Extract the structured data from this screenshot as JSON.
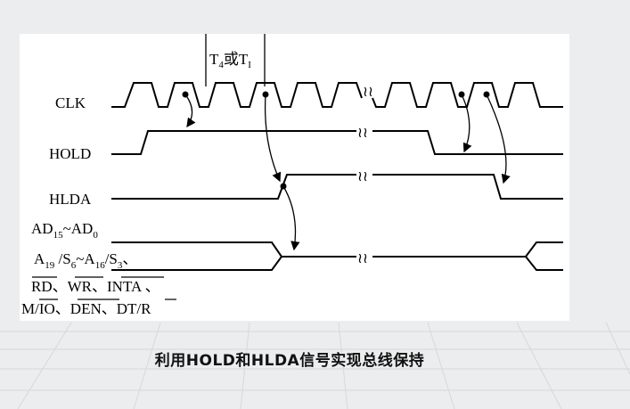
{
  "signals": {
    "clk": "CLK",
    "hold": "HOLD",
    "hlda": "HLDA",
    "bus_line1_a": "AD",
    "bus_line1_a_sub": "15",
    "bus_line1_tilde": "~AD",
    "bus_line1_b_sub": "0",
    "bus_line2_a": "A",
    "bus_line2_a_sub": "19",
    "bus_line2_b": " /S",
    "bus_line2_b_sub": "6",
    "bus_line2_c": "~A",
    "bus_line2_c_sub": "16",
    "bus_line2_d": "/S",
    "bus_line2_d_sub": "3",
    "bus_line2_sep": "、",
    "rd": "RD",
    "wr": "WR",
    "inta": "INTA",
    "m": "M/",
    "io": "IO",
    "den": "DEN",
    "dt": "DT/",
    "r": "R",
    "sep": "、"
  },
  "period_label": {
    "t": "T",
    "t_sub": "4",
    "or": "或T",
    "ti_sub": "I"
  },
  "caption": "利用HOLD和HLDA信号实现总线保持",
  "colors": {
    "background": "#ecedee",
    "panel": "#ffffff",
    "ink": "#000000"
  }
}
